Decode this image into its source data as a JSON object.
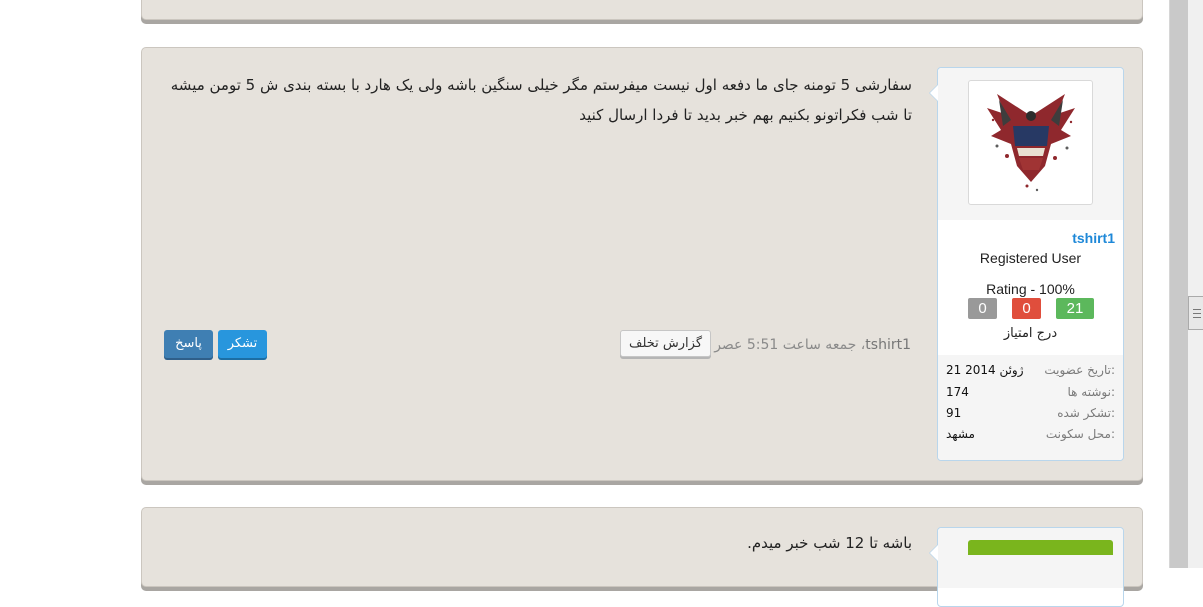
{
  "post": {
    "message_lines": [
      "سفارشی 5 تومنه جای ما دفعه اول نیست میفرستم مگر خیلی سنگین باشه ولی یک هارد با بسته بندی ش 5 تومن میشه",
      "تا شب فکراتونو بکنیم بهم خبر بدید تا فردا ارسال کنید"
    ],
    "author": "tshirt1",
    "date": "، جمعه ساعت 5:51 عصر",
    "report_label": "گزارش تخلف",
    "thanks_label": "تشکر",
    "reply_label": "پاسخ"
  },
  "user": {
    "username": "tshirt1",
    "title": "Registered User",
    "rating": "Rating - 100%",
    "badges": {
      "neutral": "0",
      "negative": "0",
      "positive": "21"
    },
    "rate_label": "درج امتیاز",
    "stats": [
      {
        "label": "تاریخ عضویت:",
        "value": "21 ژوئن 2014"
      },
      {
        "label": "نوشته ها:",
        "value": "174"
      },
      {
        "label": "تشکر شده:",
        "value": "91"
      },
      {
        "label": "محل سکونت:",
        "value": "مشهد"
      }
    ]
  },
  "next_post": {
    "message": "باشه تا 12 شب خبر میدم."
  },
  "colors": {
    "panel": "#e6e2dc",
    "link": "#1e88d8",
    "badge_grey": "#999999",
    "badge_red": "#e04e3c",
    "badge_green": "#5cb85c"
  }
}
